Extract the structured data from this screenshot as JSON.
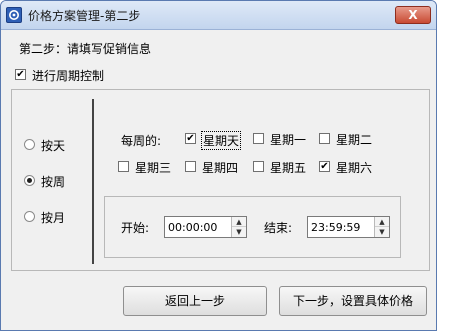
{
  "window": {
    "title": "价格方案管理-第二步",
    "close_label": "X"
  },
  "step": {
    "instruction": "第二步：请填写促销信息",
    "period_control_label": "进行周期控制",
    "period_control_checked": true
  },
  "modes": [
    {
      "label": "按天",
      "selected": false
    },
    {
      "label": "按周",
      "selected": true
    },
    {
      "label": "按月",
      "selected": false
    }
  ],
  "weekly": {
    "label": "每周的:",
    "days": [
      {
        "label": "星期天",
        "checked": true
      },
      {
        "label": "星期一",
        "checked": false
      },
      {
        "label": "星期二",
        "checked": false
      },
      {
        "label": "星期三",
        "checked": false
      },
      {
        "label": "星期四",
        "checked": false
      },
      {
        "label": "星期五",
        "checked": false
      },
      {
        "label": "星期六",
        "checked": true
      }
    ]
  },
  "time": {
    "start_label": "开始:",
    "start_value": "00:00:00",
    "end_label": "结束:",
    "end_value": "23:59:59"
  },
  "buttons": {
    "back": "返回上一步",
    "next": "下一步，设置具体价格"
  }
}
